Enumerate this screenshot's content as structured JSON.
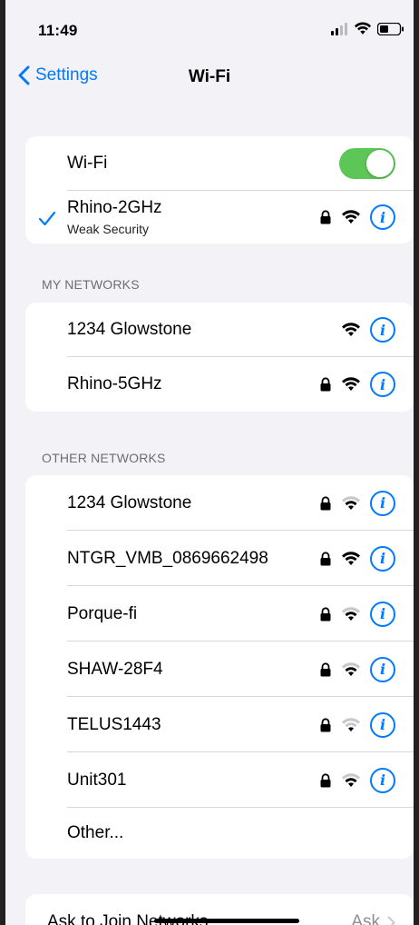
{
  "status": {
    "time": "11:49"
  },
  "nav": {
    "back_label": "Settings",
    "title": "Wi-Fi"
  },
  "wifi_card": {
    "toggle_label": "Wi-Fi",
    "toggle_on": true,
    "connected_name": "Rhino-2GHz",
    "connected_sub": "Weak Security"
  },
  "my_networks": {
    "header": "MY NETWORKS",
    "items": [
      {
        "name": "1234 Glowstone",
        "locked": false
      },
      {
        "name": "Rhino-5GHz",
        "locked": true
      }
    ]
  },
  "other_networks": {
    "header": "OTHER NETWORKS",
    "items": [
      {
        "name": "1234 Glowstone",
        "locked": true
      },
      {
        "name": "NTGR_VMB_0869662498",
        "locked": true
      },
      {
        "name": "Porque-fi",
        "locked": true
      },
      {
        "name": "SHAW-28F4",
        "locked": true
      },
      {
        "name": "TELUS1443",
        "locked": true
      },
      {
        "name": "Unit301",
        "locked": true
      }
    ],
    "other_label": "Other..."
  },
  "ask_to_join": {
    "label": "Ask to Join Networks",
    "value": "Ask"
  },
  "colors": {
    "accent": "#007aff",
    "toggle_on": "#5cc657",
    "background": "#f2f2f7"
  }
}
